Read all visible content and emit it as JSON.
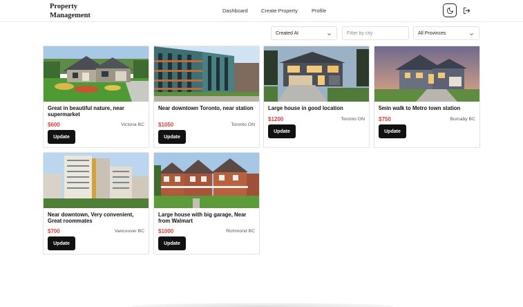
{
  "header": {
    "brand_line1": "Property",
    "brand_line2": "Management",
    "nav": {
      "dashboard": "Dashboard",
      "create_property": "Create Property",
      "profile": "Profile"
    },
    "theme_icon": "moon-icon",
    "logout_icon": "logout-icon"
  },
  "filters": {
    "sort_value": "Created At",
    "city_placeholder": "Filter by city",
    "province_value": "All Provinces"
  },
  "colors": {
    "price": "#e23a3a",
    "button": "#111111"
  },
  "properties": [
    {
      "title": "Great in beautiful nature, near supermarket",
      "price": "$600",
      "location": "Victoria BC",
      "button": "Update",
      "image": "craftsman-house-with-garden"
    },
    {
      "title": "Near downtown Toronto, near station",
      "price": "$1050",
      "location": "Toronto ON",
      "button": "Update",
      "image": "modern-apartment-complex"
    },
    {
      "title": "Large house in good location",
      "price": "$1200",
      "location": "Toronto ON",
      "button": "Update",
      "image": "modern-house-at-dusk"
    },
    {
      "title": "5min walk to Metro town station",
      "price": "$750",
      "location": "Burnaby BC",
      "button": "Update",
      "image": "suburban-house-at-sunset"
    },
    {
      "title": "Near downtown, Very convenient, Great roommates",
      "price": "$700",
      "location": "Vancouver BC",
      "button": "Update",
      "image": "highrise-apartment-tower"
    },
    {
      "title": "Large house with big garage, Near from Walmart",
      "price": "$1000",
      "location": "Richmond BC",
      "button": "Update",
      "image": "brick-townhouses"
    }
  ]
}
